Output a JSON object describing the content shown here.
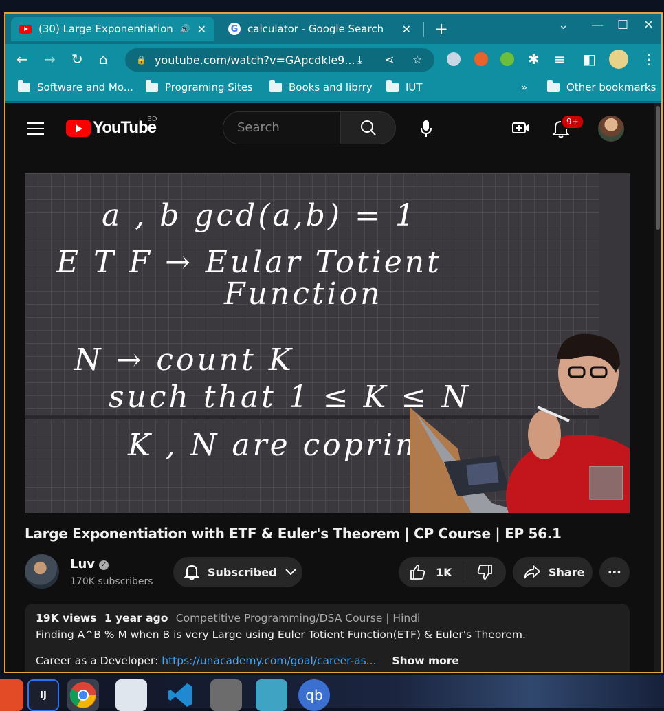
{
  "browser": {
    "tabs": [
      {
        "title": "(30) Large Exponentiation",
        "active": true
      },
      {
        "title": "calculator - Google Search",
        "active": false
      }
    ],
    "url": "youtube.com/watch?v=GApcdkIe9...",
    "new_tab_symbol": "+",
    "bookmarks": [
      "Software and Mo...",
      "Programing Sites",
      "Books and librry",
      "IUT"
    ],
    "bookmarks_overflow": "»",
    "other_bookmarks": "Other bookmarks"
  },
  "youtube": {
    "logo_text": "YouTube",
    "country_code": "BD",
    "search_placeholder": "Search",
    "notification_count": "9+"
  },
  "video": {
    "board_text": {
      "line1": "a , b    gcd(a,b) = 1",
      "line2": "E T F → Eular Totient",
      "line3": "Function",
      "line4": "N → count  K",
      "line5": "such that 1 ≤ K ≤ N",
      "line6": "K , N  are coprime"
    },
    "title": "Large Exponentiation with ETF & Euler's Theorem | CP Course | EP 56.1",
    "channel": {
      "name": "Luv",
      "subscribers": "170K subscribers"
    },
    "actions": {
      "subscribed": "Subscribed",
      "likes": "1K",
      "share": "Share"
    },
    "description": {
      "views": "19K views",
      "age": "1 year ago",
      "playlist": "Competitive Programming/DSA Course | Hindi",
      "summary": "Finding A^B % M when B is very Large using Euler Totient Function(ETF) & Euler's Theorem.",
      "career_label": "Career as a Developer:",
      "career_link": "https://unacademy.com/goal/career-as...",
      "show_more": "Show more"
    }
  },
  "colors": {
    "chrome_frame": "#0f7185",
    "chrome_toolbar": "#108fa3",
    "youtube_red": "#ff0000",
    "page_bg": "#0f0f0f",
    "window_border": "#e8a33d"
  }
}
